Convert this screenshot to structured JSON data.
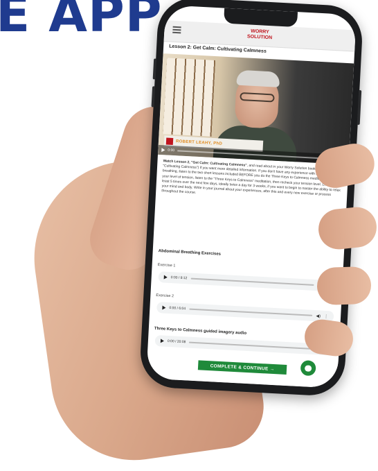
{
  "headline": "E APP",
  "app": {
    "logo_line1": "WORRY",
    "logo_line2": "SOLUTION",
    "lesson_title": "Lesson 2: Get Calm: Cultivating Calmness"
  },
  "video": {
    "presenter_name": "ROBERT LEAHY, PhD",
    "time": "0:00"
  },
  "body": {
    "lead_bold": "Watch Lesson 2, \"Get Calm: Cultivating Calmness\"",
    "text": ", and read about in your Worry Solution book (Chapter 2, \"Cultivating Calmness\") if you want more detailed information. If you don't have any experience with abdominal breathing, listen to the two short lessons included BEFORE you do the Three Keys to Calmness meditation. Note your level of tension, listen to the \"Three Keys to Calmness\" meditation, then recheck your tension level. Listen to it at least 5 times over the next few days, ideally twice a day for 3 weeks, if you want to begin to master the ability to relax your mind and body. Write in your journal about your experiences, after this and every new exercise or process throughout the course."
  },
  "section": {
    "title": "Abdominal Breathing Exercises"
  },
  "exercises": [
    {
      "label": "Exercise 1",
      "time": "0:00 / 8:12"
    },
    {
      "label": "Exercise 2",
      "time": "0:00 / 6:04"
    },
    {
      "label": "Three Keys to Calmness guided imagery audio",
      "time": "0:00 / 20:08"
    }
  ],
  "cta": {
    "label": "COMPLETE & CONTINUE →"
  },
  "colors": {
    "headline": "#1f3b8f",
    "accent_green": "#1f8a3a",
    "logo_red": "#c0151e"
  }
}
